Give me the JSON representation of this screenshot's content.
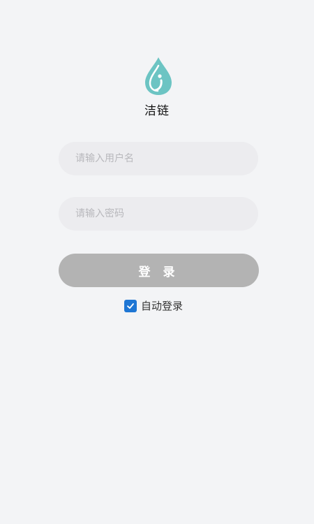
{
  "app": {
    "name": "洁链",
    "logo_icon": "water-drop-icon",
    "brand_color": "#6cc4c3"
  },
  "login_form": {
    "username": {
      "placeholder": "请输入用户名",
      "value": ""
    },
    "password": {
      "placeholder": "请输入密码",
      "value": ""
    },
    "login_label": "登 录",
    "login_button_color": "#b3b3b3"
  },
  "auto_login": {
    "label": "自动登录",
    "checked": true,
    "checkbox_color": "#1e76d4"
  }
}
